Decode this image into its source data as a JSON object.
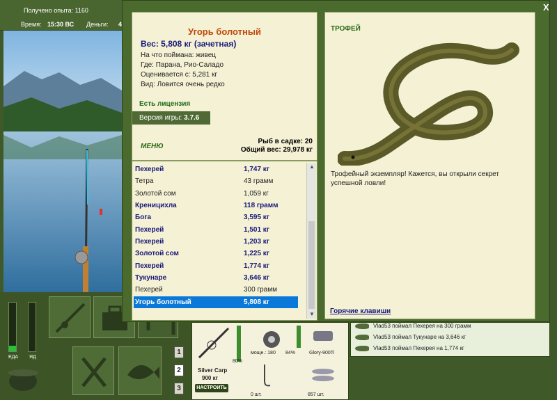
{
  "status": {
    "xp": "Получено опыта: 1160",
    "time_label": "Время:",
    "time_value": "15:30 ВС",
    "money_label": "Деньги:",
    "money_value": "4"
  },
  "meters": {
    "food_label": "ЕДА",
    "poison_label": "ЯД",
    "food_level": 0.12,
    "poison_level": 0
  },
  "page_buttons": [
    "1",
    "2",
    "3"
  ],
  "gear": {
    "bait_name": "Silver Carp",
    "bait_weight": "900 кг",
    "setup_button": "НАСТРОИТЬ",
    "percent_1": "80%",
    "power_label": "мощн.: 180",
    "percent_2": "84%",
    "reel_name": "Glory-900Ti",
    "count_1": "0 шт.",
    "count_2": "857 шт."
  },
  "feed": {
    "rows": [
      "Vlad53 поймал Пехерея на 300 грамм",
      "Vlad53 поймал Тукунаре на 3,646 кг",
      "Vlad53 поймал Пехерея на 1,774 кг"
    ]
  },
  "modal": {
    "close": "X",
    "fish_title": "Угорь болотный",
    "weight": "Вес: 5,808 кг (зачетная)",
    "caught_on": "На что поймана: живец",
    "location": "Где: Парана, Рио-Саладо",
    "valued_from": "Оценивается с: 5,281 кг",
    "kind": "Вид: Ловится очень редко",
    "license": "Есть лицензия",
    "version_label": "Версия игры:",
    "version_value": "3.7.6",
    "menu": "МЕНЮ",
    "cage_count": "Рыб в садке: 20",
    "cage_weight": "Общий вес: 29,978 кг",
    "trophy_label": "ТРОФЕЙ",
    "trophy_text": "Трофейный экземпляр! Кажется, вы открыли секрет успешной ловли!",
    "hotkeys": "Горячие клавиши"
  },
  "catches": [
    {
      "name": "Пехерей",
      "weight": "1,747 кг",
      "style": "bold"
    },
    {
      "name": "Тетра",
      "weight": "43 грамм",
      "style": "plain"
    },
    {
      "name": "Золотой сом",
      "weight": "1,059 кг",
      "style": "plain"
    },
    {
      "name": "Креницихла",
      "weight": "118 грамм",
      "style": "bold"
    },
    {
      "name": "Бога",
      "weight": "3,595 кг",
      "style": "bold"
    },
    {
      "name": "Пехерей",
      "weight": "1,501 кг",
      "style": "bold"
    },
    {
      "name": "Пехерей",
      "weight": "1,203 кг",
      "style": "bold"
    },
    {
      "name": "Золотой сом",
      "weight": "1,225 кг",
      "style": "bold"
    },
    {
      "name": "Пехерей",
      "weight": "1,774 кг",
      "style": "bold"
    },
    {
      "name": "Тукунаре",
      "weight": "3,646 кг",
      "style": "bold"
    },
    {
      "name": "Пехерей",
      "weight": "300 грамм",
      "style": "plain"
    },
    {
      "name": "Угорь болотный",
      "weight": "5,808 кг",
      "style": "sel"
    }
  ]
}
